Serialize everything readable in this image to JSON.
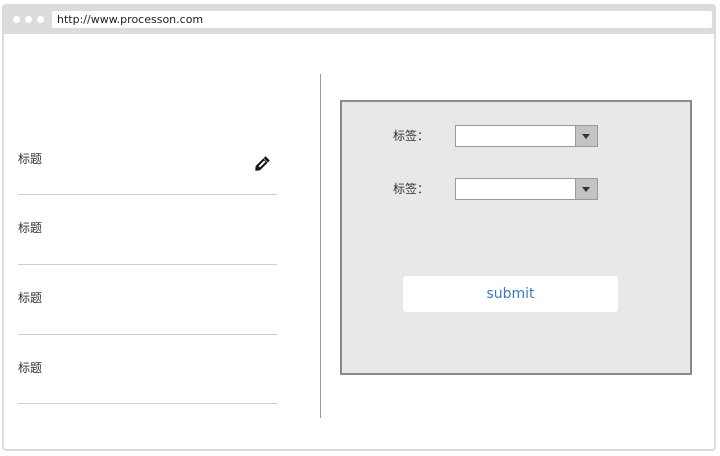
{
  "browser": {
    "url": "http://www.processon.com"
  },
  "list": {
    "items": [
      {
        "title": "标题"
      },
      {
        "title": "标题"
      },
      {
        "title": "标题"
      },
      {
        "title": "标题"
      }
    ],
    "edit_icon": "pencil-icon"
  },
  "form": {
    "fields": [
      {
        "label": "标签：",
        "value": ""
      },
      {
        "label": "标签：",
        "value": ""
      }
    ],
    "submit_label": "submit"
  },
  "colors": {
    "panel_bg": "#e8e8e8",
    "link_blue": "#3a7bc8"
  }
}
